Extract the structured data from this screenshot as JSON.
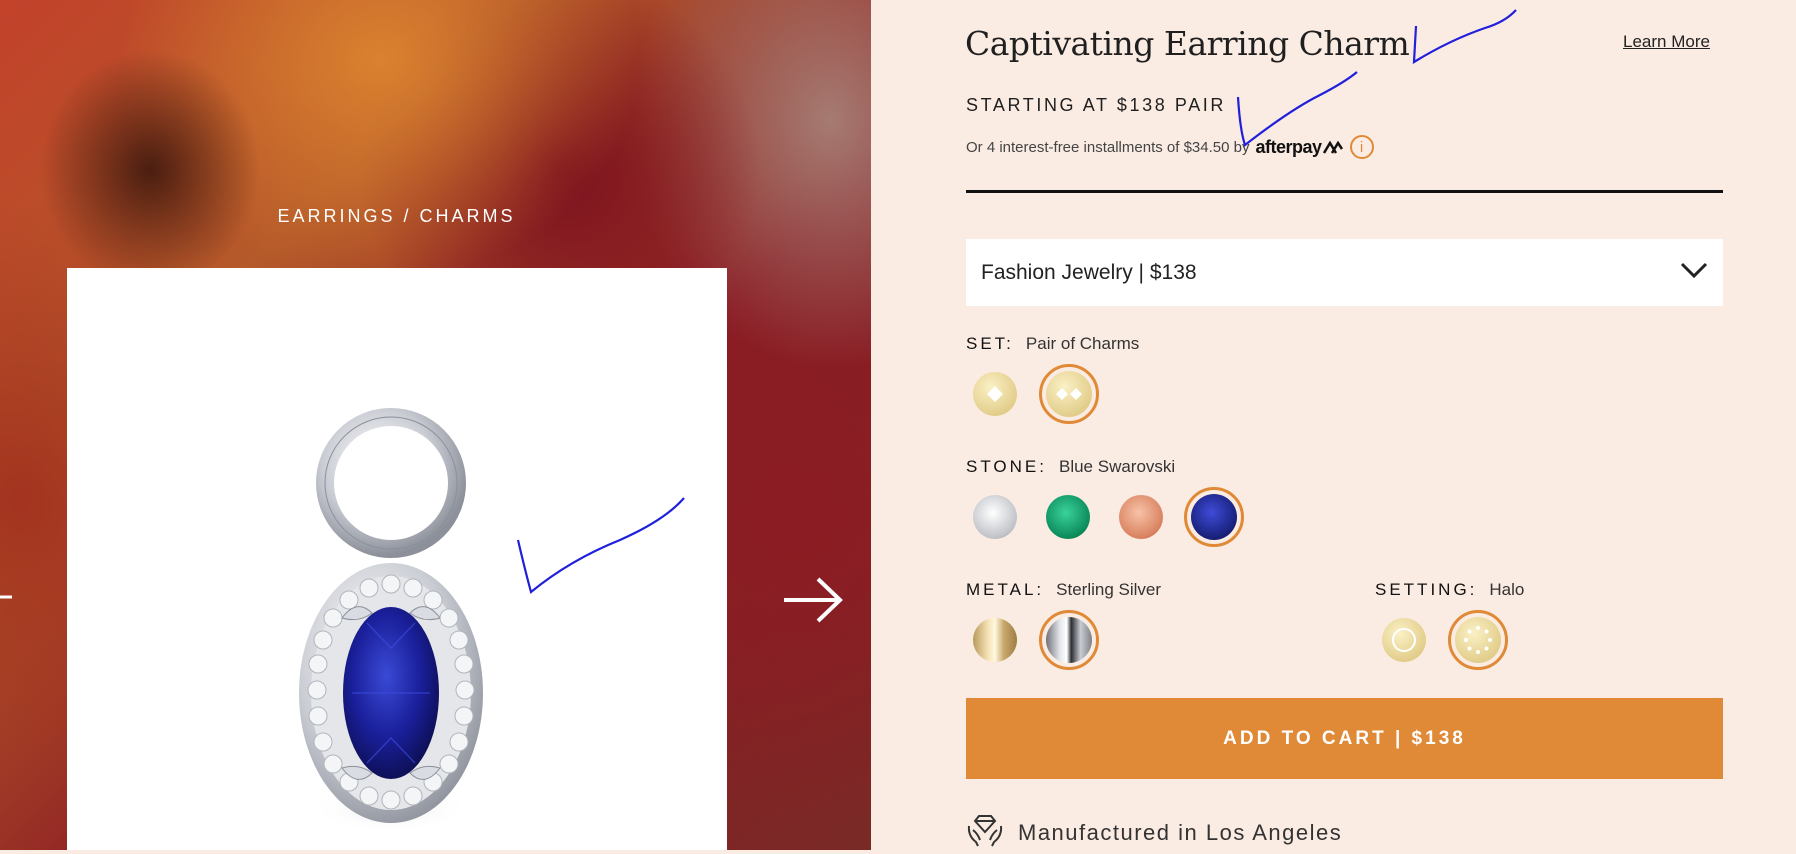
{
  "breadcrumb": "EARRINGS / CHARMS",
  "product": {
    "title": "Captivating Earring Charm",
    "learn_more": "Learn More",
    "price_line": "STARTING AT $138 PAIR",
    "afterpay_text": "Or 4 interest-free installments of $34.50 by",
    "afterpay_logo": "afterpay",
    "info_icon": "i"
  },
  "select": {
    "value": "Fashion Jewelry | $138",
    "icon": "chevron-down-icon"
  },
  "options": {
    "set": {
      "key": "SET:",
      "value": "Pair of Charms",
      "swatches": [
        "single-charm",
        "pair-of-charms"
      ]
    },
    "stone": {
      "key": "STONE:",
      "value": "Blue Swarovski",
      "swatches": [
        "white",
        "emerald",
        "peach",
        "blue"
      ]
    },
    "metal": {
      "key": "METAL:",
      "value": "Sterling Silver",
      "swatches": [
        "gold",
        "sterling-silver"
      ]
    },
    "setting": {
      "key": "SETTING:",
      "value": "Halo",
      "swatches": [
        "solitaire",
        "halo"
      ]
    }
  },
  "add_to_cart": "ADD TO CART | $138",
  "manufactured": "Manufactured in Los Angeles",
  "colors": {
    "accent": "#e08936",
    "panel_bg": "#fbece3",
    "stone_blue": "#1a237e",
    "annotation_ink": "#1f1fdc"
  }
}
